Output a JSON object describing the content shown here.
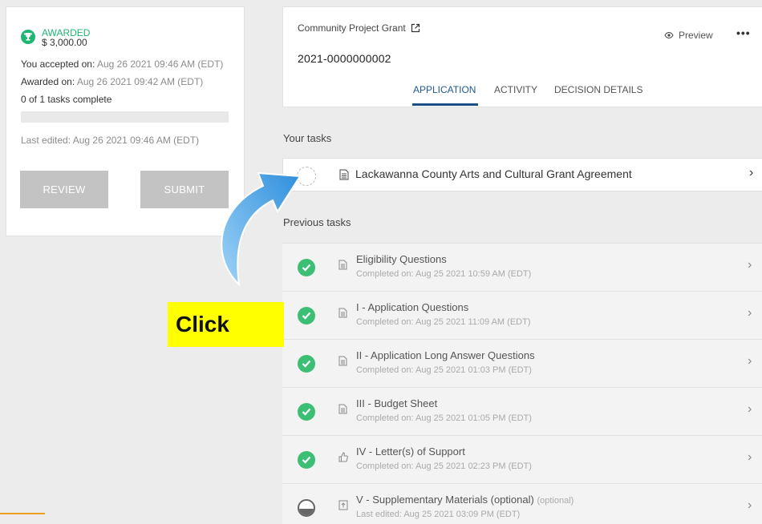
{
  "award": {
    "status": "AWARDED",
    "amount": "$ 3,000.00",
    "accepted_label": "You accepted on:",
    "accepted_value": "Aug 26 2021 09:46 AM (EDT)",
    "awarded_label": "Awarded on:",
    "awarded_value": "Aug 26 2021 09:42 AM (EDT)",
    "tasks_complete": "0 of 1 tasks complete",
    "tasks_progress": 0,
    "last_edited": "Last edited: Aug 26 2021 09:46 AM (EDT)",
    "review_label": "REVIEW",
    "submit_label": "SUBMIT"
  },
  "header": {
    "grant_name": "Community Project Grant",
    "app_id": "2021-0000000002",
    "preview_label": "Preview",
    "more_label": "•••",
    "tabs": [
      {
        "label": "APPLICATION",
        "active": true
      },
      {
        "label": "ACTIVITY",
        "active": false
      },
      {
        "label": "DECISION DETAILS",
        "active": false
      }
    ]
  },
  "your_tasks": {
    "heading": "Your tasks",
    "task": "Lackawanna County Arts and Cultural Grant Agreement"
  },
  "previous_tasks": {
    "heading": "Previous tasks",
    "items": [
      {
        "title": "Eligibility Questions",
        "sub": "Completed on: Aug 25 2021 10:59 AM (EDT)",
        "status": "complete",
        "icon": "document-icon"
      },
      {
        "title": "I - Application Questions",
        "sub": "Completed on: Aug 25 2021 11:09 AM (EDT)",
        "status": "complete",
        "icon": "document-icon"
      },
      {
        "title": "II - Application Long Answer Questions",
        "sub": "Completed on: Aug 25 2021 01:03 PM (EDT)",
        "status": "complete",
        "icon": "document-icon"
      },
      {
        "title": "III - Budget Sheet",
        "sub": "Completed on: Aug 25 2021 01:05 PM (EDT)",
        "status": "complete",
        "icon": "document-icon"
      },
      {
        "title": "IV - Letter(s) of Support",
        "sub": "Completed on: Aug 25 2021 02:23 PM (EDT)",
        "status": "complete",
        "icon": "thumbs-up-icon"
      },
      {
        "title": "V - Supplementary Materials (optional)",
        "optional_tag": "(optional)",
        "sub": "Last edited: Aug 25 2021 03:09 PM (EDT)",
        "status": "in-progress",
        "icon": "upload-icon"
      }
    ]
  },
  "annotation": {
    "click_label": "Click"
  },
  "colors": {
    "awarded_green": "#21b573",
    "check_green": "#3cbf75",
    "tab_active": "#1e5a96",
    "button_disabled": "#c3c3c3",
    "highlight_yellow": "#ffff00",
    "arrow_blue": "#3aa0e8"
  }
}
